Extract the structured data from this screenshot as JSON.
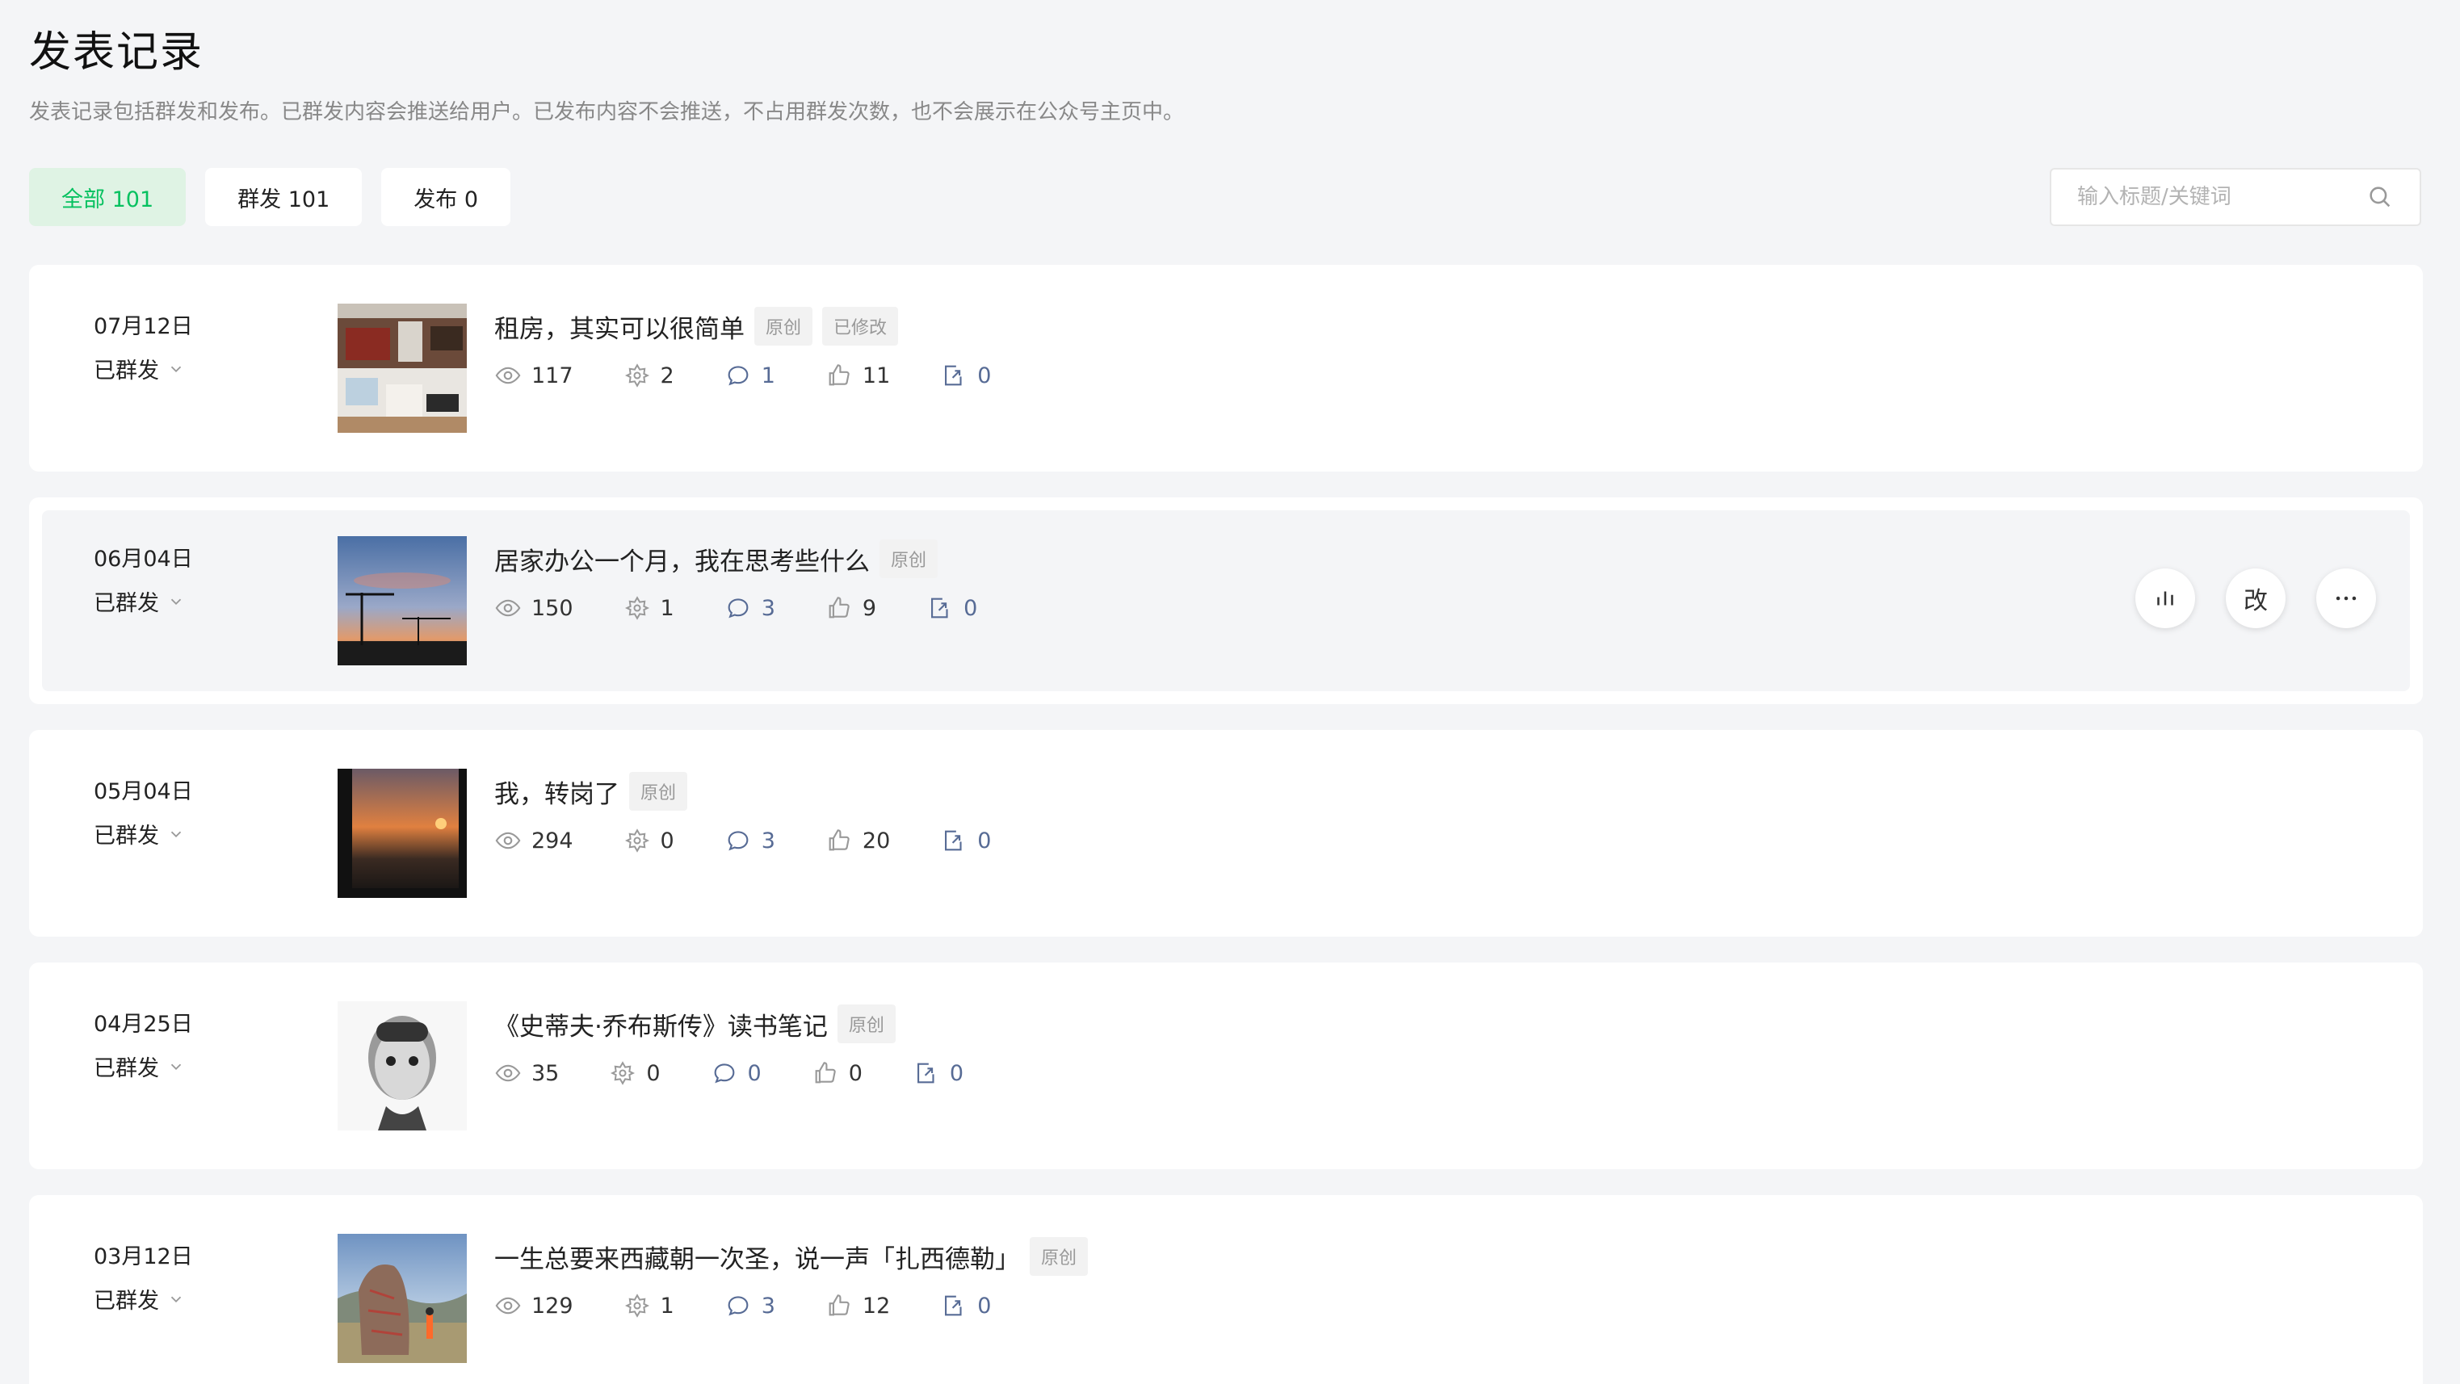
{
  "page": {
    "title": "发表记录",
    "description": "发表记录包括群发和发布。已群发内容会推送给用户。已发布内容不会推送，不占用群发次数，也不会展示在公众号主页中。"
  },
  "tabs": [
    {
      "label": "全部 101",
      "active": true
    },
    {
      "label": "群发 101",
      "active": false
    },
    {
      "label": "发布 0",
      "active": false
    }
  ],
  "search": {
    "placeholder": "输入标题/关键词"
  },
  "articles": [
    {
      "date": "07月12日",
      "status": "已群发",
      "title": "租房，其实可以很简单",
      "tags": [
        "原创",
        "已修改"
      ],
      "views": "117",
      "shares": "2",
      "comments": "1",
      "likes": "11",
      "forwards": "0",
      "thumb": "room-photo"
    },
    {
      "date": "06月04日",
      "status": "已群发",
      "title": "居家办公一个月，我在思考些什么",
      "tags": [
        "原创"
      ],
      "views": "150",
      "shares": "1",
      "comments": "3",
      "likes": "9",
      "forwards": "0",
      "thumb": "sunset-cranes-photo"
    },
    {
      "date": "05月04日",
      "status": "已群发",
      "title": "我，转岗了",
      "tags": [
        "原创"
      ],
      "views": "294",
      "shares": "0",
      "comments": "3",
      "likes": "20",
      "forwards": "0",
      "thumb": "window-sunset-photo"
    },
    {
      "date": "04月25日",
      "status": "已群发",
      "title": "《史蒂夫·乔布斯传》读书笔记",
      "tags": [
        "原创"
      ],
      "views": "35",
      "shares": "0",
      "comments": "0",
      "likes": "0",
      "forwards": "0",
      "thumb": "portrait-photo"
    },
    {
      "date": "03月12日",
      "status": "已群发",
      "title": "一生总要来西藏朝一次圣，说一声「扎西德勒」",
      "tags": [
        "原创"
      ],
      "views": "129",
      "shares": "1",
      "comments": "3",
      "likes": "12",
      "forwards": "0",
      "thumb": "tibet-stone-photo"
    }
  ],
  "hover_actions": {
    "data_icon": "bar-chart-icon",
    "edit_label": "改",
    "more_icon": "more-dots-icon"
  },
  "colors": {
    "accent_green": "#07c160",
    "active_tab_bg": "#dff3e4",
    "link_blue": "#576b95",
    "background": "#f4f5f7"
  }
}
